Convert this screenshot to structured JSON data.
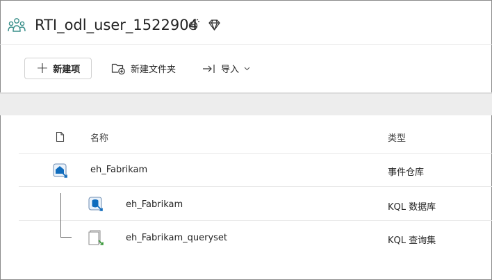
{
  "header": {
    "workspace_title": "RTI_odl_user_1522904"
  },
  "toolbar": {
    "new_item_label": "新建项",
    "new_folder_label": "新建文件夹",
    "import_label": "导入"
  },
  "table": {
    "columns": {
      "name": "名称",
      "type": "类型"
    },
    "rows": [
      {
        "name": "eh_Fabrikam",
        "type": "事件仓库",
        "icon": "eventhouse-icon"
      },
      {
        "name": "eh_Fabrikam",
        "type": "KQL 数据库",
        "icon": "kql-database-icon"
      },
      {
        "name": "eh_Fabrikam_queryset",
        "type": "KQL 查询集",
        "icon": "kql-queryset-icon"
      }
    ]
  },
  "colors": {
    "accent_teal": "#3a8f8a",
    "eventhouse_blue": "#0f6cbd",
    "queryset_green": "#3c9a3c"
  }
}
